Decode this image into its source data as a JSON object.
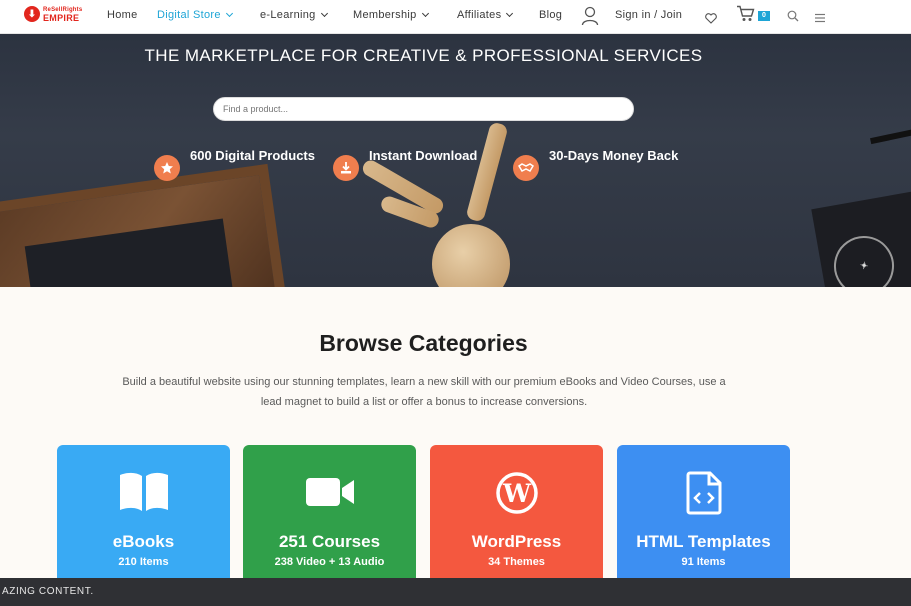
{
  "nav": {
    "logo_top": "ReSellRights",
    "logo_bottom": "EMPIRE",
    "items": [
      {
        "label": "Home"
      },
      {
        "label": "Digital Store"
      },
      {
        "label": "e-Learning"
      },
      {
        "label": "Membership"
      },
      {
        "label": "Affiliates"
      },
      {
        "label": "Blog"
      }
    ],
    "signin": "Sign in / Join",
    "cart_count": "0",
    "accent": "#1ea5d6"
  },
  "hero": {
    "title": "THE MARKETPLACE FOR CREATIVE & PROFESSIONAL SERVICES",
    "search_placeholder": "Find a product...",
    "features": [
      {
        "label": "600 Digital Products",
        "icon": "star-icon"
      },
      {
        "label": "Instant Download",
        "icon": "download-icon"
      },
      {
        "label": "30-Days Money Back",
        "icon": "handshake-icon"
      }
    ],
    "feature_icon_color": "#f07e4e"
  },
  "browse": {
    "title": "Browse Categories",
    "description": "Build a beautiful website using our stunning templates, learn a new skill with our premium eBooks and Video Courses, use a lead magnet to build a list or offer a bonus to increase conversions.",
    "categories": [
      {
        "title": "eBooks",
        "count": "210 Items",
        "color": "#39aaf4",
        "icon": "book-icon"
      },
      {
        "title": "251 Courses",
        "count": "238 Video + 13 Audio",
        "color": "#30a04a",
        "icon": "video-camera-icon"
      },
      {
        "title": "WordPress",
        "count": "34 Themes",
        "color": "#f4583f",
        "icon": "wordpress-icon"
      },
      {
        "title": "HTML Templates",
        "count": "91 Items",
        "color": "#3d8ff2",
        "icon": "code-file-icon"
      }
    ]
  },
  "ticker": {
    "text": "AZING CONTENT."
  }
}
